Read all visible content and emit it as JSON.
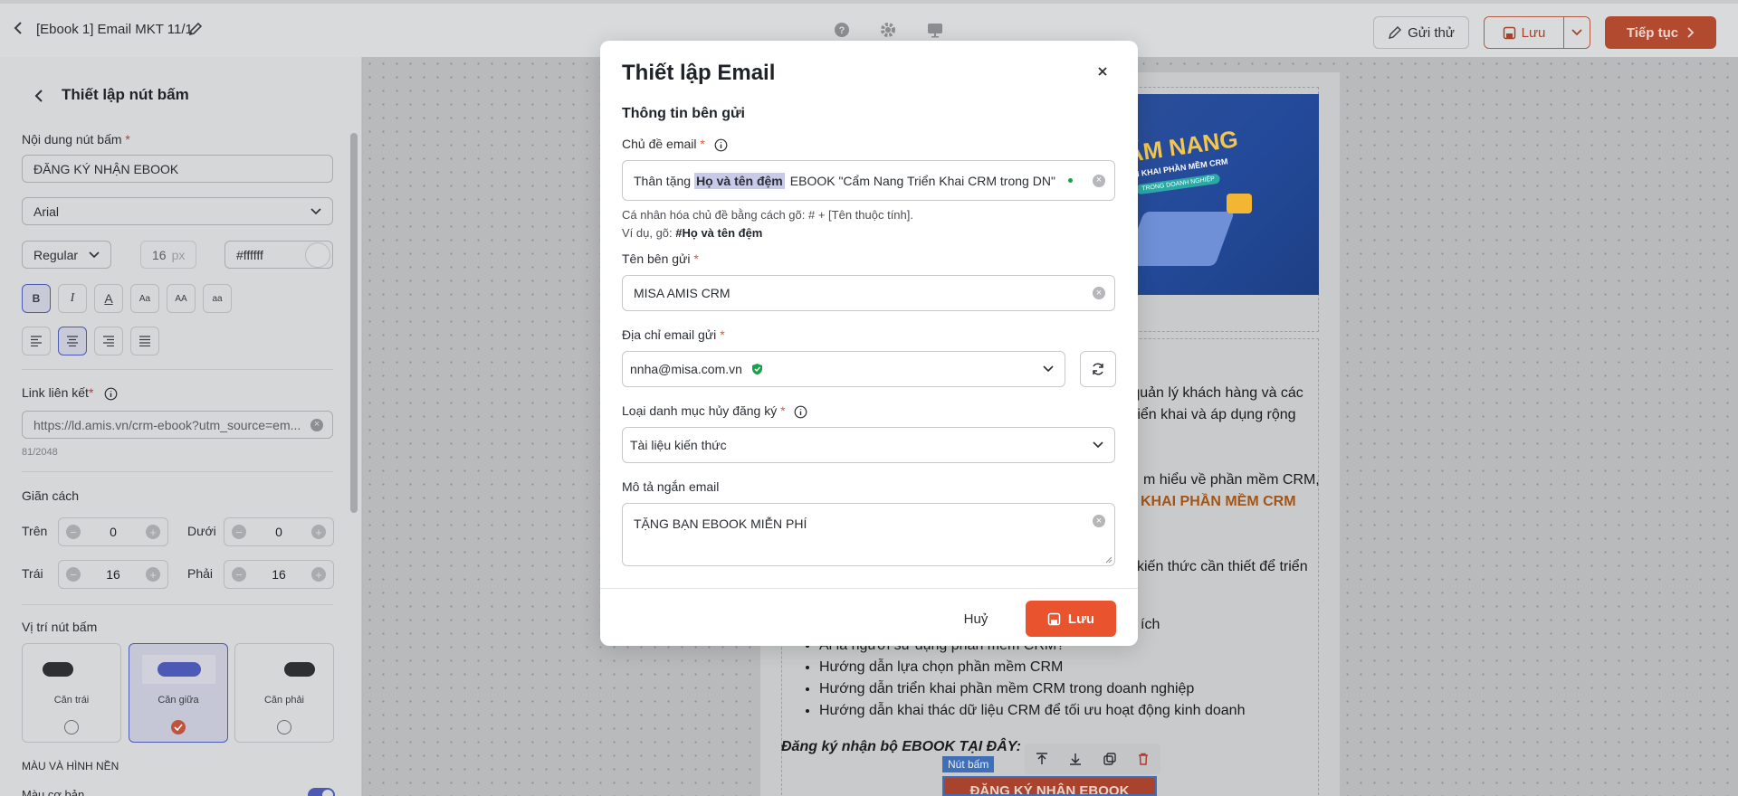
{
  "topbar": {
    "back_label": "‹",
    "doc_title": "[Ebook 1] Email MKT 11/1",
    "send_test": "Gửi thử",
    "save": "Lưu",
    "continue": "Tiếp tục"
  },
  "left_panel": {
    "title": "Thiết lập nút bấm",
    "button_content_label": "Nội dung nút bấm",
    "button_content_value": "ĐĂNG KÝ NHẬN EBOOK",
    "font_family": "Arial",
    "font_weight": "Regular",
    "font_size": "16",
    "font_size_unit": "px",
    "text_color": "#ffffff",
    "format_buttons": [
      "B",
      "I",
      "A",
      "Aa",
      "AA",
      "aa"
    ],
    "link_label": "Link liên kết",
    "link_value": "https://ld.amis.vn/crm-ebook?utm_source=em...",
    "link_count": "81/2048",
    "spacing_label": "Giãn cách",
    "top_label": "Trên",
    "top_value": "0",
    "bottom_label": "Dưới",
    "bottom_value": "0",
    "left_label": "Trái",
    "left_value": "16",
    "right_label": "Phải",
    "right_value": "16",
    "position_label": "Vị trí nút bấm",
    "positions": [
      "Căn trái",
      "Căn giữa",
      "Căn phải"
    ],
    "selected_position": "Căn giữa",
    "bg_section": "MÀU VÀ HÌNH NỀN",
    "base_color": "Màu cơ bản"
  },
  "canvas": {
    "cover_title_1": "CẨM NANG",
    "cover_title_2": "TRIỂN KHAI PHẦN MỀM CRM",
    "cover_badge": "TRONG DOANH NGHIỆP",
    "line1": "u quản lý khách hàng và các",
    "line2": "riển khai và áp dụng rộng",
    "line3": "m hiểu về phần mềm CRM,",
    "line4": "KHAI PHẦN MỀM CRM",
    "line5": "kiến thức cần thiết để triển",
    "line6": "ích",
    "bullets": [
      "Ai là người sử dụng phần mềm CRM?",
      "Hướng dẫn lựa chọn phần mềm CRM",
      "Hướng dẫn triển khai phần mềm CRM trong doanh nghiệp",
      "Hướng dẫn khai thác dữ liệu CRM để tối ưu hoạt động kinh doanh"
    ],
    "cta_text": "Đăng ký nhận bộ EBOOK TẠI ĐÂY:",
    "button_tag": "Nút bấm",
    "button_label": "ĐĂNG KÝ NHẬN EBOOK"
  },
  "modal": {
    "title": "Thiết lập Email",
    "section": "Thông tin bên gửi",
    "subject_label": "Chủ đề email",
    "subject_prefix": "Thân tặng",
    "subject_token": "Họ và tên đệm",
    "subject_suffix": "EBOOK \"Cẩm Nang Triển Khai CRM trong DN\"",
    "hint_1": "Cá nhân hóa chủ đề bằng cách gõ: # + [Tên thuộc tính].",
    "hint_2_prefix": "Ví dụ, gõ:",
    "hint_2_example": "#Họ và tên đệm",
    "sender_name_label": "Tên bên gửi",
    "sender_name_value": "MISA AMIS CRM",
    "sender_email_label": "Địa chỉ email gửi",
    "sender_email_value": "nnha@misa.com.vn",
    "unsubscribe_label": "Loại danh mục hủy đăng ký",
    "unsubscribe_value": "Tài liệu kiến thức",
    "desc_label": "Mô tả ngắn email",
    "desc_value": "TẶNG BẠN EBOOK MIỄN PHÍ",
    "cancel": "Huỷ",
    "save": "Lưu"
  },
  "colors": {
    "accent": "#e9542f",
    "primary": "#4c5ab5",
    "overlay": "#b5b6b8"
  }
}
